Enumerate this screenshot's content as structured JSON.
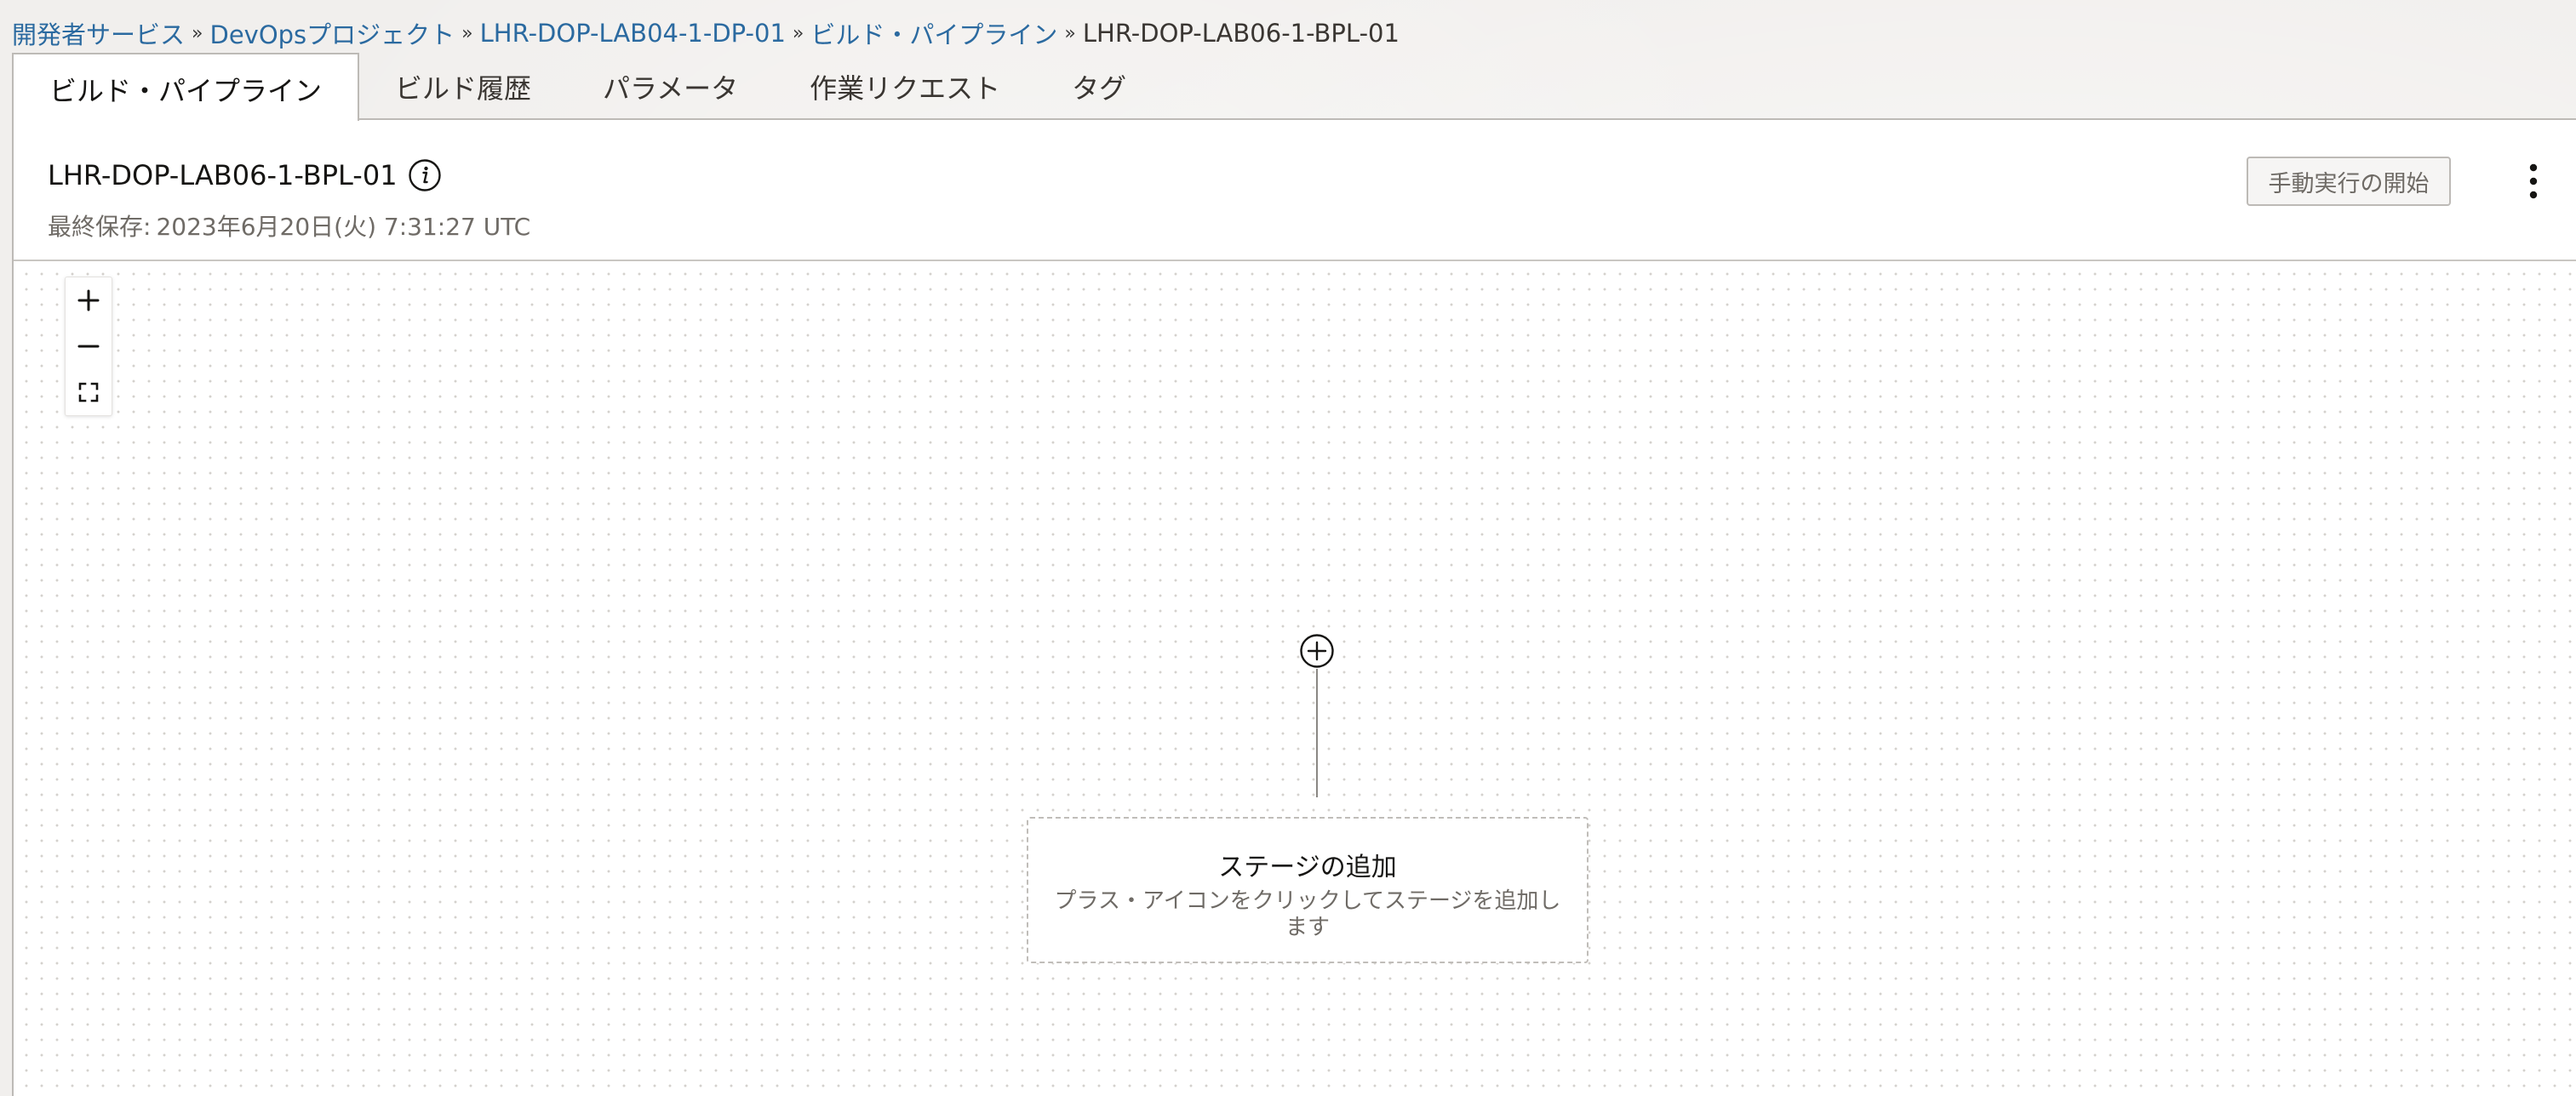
{
  "breadcrumb": {
    "items": [
      {
        "label": "開発者サービス"
      },
      {
        "label": "DevOpsプロジェクト"
      },
      {
        "label": "LHR-DOP-LAB04-1-DP-01"
      },
      {
        "label": "ビルド・パイプライン"
      }
    ],
    "separator": "»",
    "current": "LHR-DOP-LAB06-1-BPL-01"
  },
  "tabs": [
    {
      "label": "ビルド・パイプライン",
      "active": true
    },
    {
      "label": "ビルド履歴",
      "active": false
    },
    {
      "label": "パラメータ",
      "active": false
    },
    {
      "label": "作業リクエスト",
      "active": false
    },
    {
      "label": "タグ",
      "active": false
    }
  ],
  "header": {
    "title": "LHR-DOP-LAB06-1-BPL-01",
    "info_icon": "info-icon",
    "last_saved_label": "最終保存:",
    "last_saved_value": "2023年6月20日(火) 7:31:27 UTC",
    "manual_run_label": "手動実行の開始",
    "more_icon": "kebab-menu-icon"
  },
  "zoom_controls": {
    "zoom_in_icon": "plus-icon",
    "zoom_out_icon": "minus-icon",
    "fit_icon": "fit-to-screen-icon"
  },
  "stage_placeholder": {
    "add_icon": "add-circle-icon",
    "title": "ステージの追加",
    "description": "プラス・アイコンをクリックしてステージを追加します"
  },
  "colors": {
    "link": "#2b6aa0",
    "text": "#161513",
    "muted": "#6f6b66",
    "border": "#bdbab6"
  }
}
